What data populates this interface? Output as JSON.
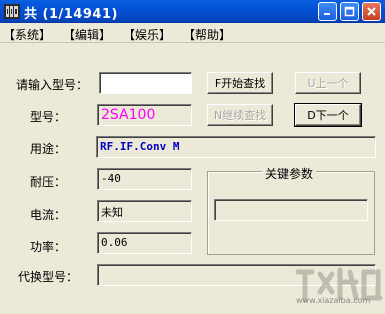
{
  "window": {
    "title": "共 (1/14941)"
  },
  "menu": [
    "【系统】",
    "【编辑】",
    "【娱乐】",
    "【帮助】"
  ],
  "form": {
    "input_label": "请输入型号：",
    "input_value": "",
    "model_label": "型号：",
    "model_value": "2SA100",
    "usage_label": "用途：",
    "usage_value": "RF.IF.Conv  M",
    "voltage_label": "耐压：",
    "voltage_value": "-40",
    "current_label": "电流：",
    "current_value": "未知",
    "power_label": "功率：",
    "power_value": "0.06",
    "replace_label": "代换型号：",
    "replace_value": ""
  },
  "buttons": {
    "start_search": "F开始查找",
    "continue_search": "N继续查找",
    "prev": "U上一个",
    "next": "D下一个"
  },
  "group": {
    "title": "关键参数",
    "value": ""
  },
  "watermark": {
    "url": "www.xiazaiba.com"
  },
  "colors": {
    "model_text": "#ff00ff",
    "usage_text": "#0000c0",
    "titlebar": "#0250d4"
  }
}
